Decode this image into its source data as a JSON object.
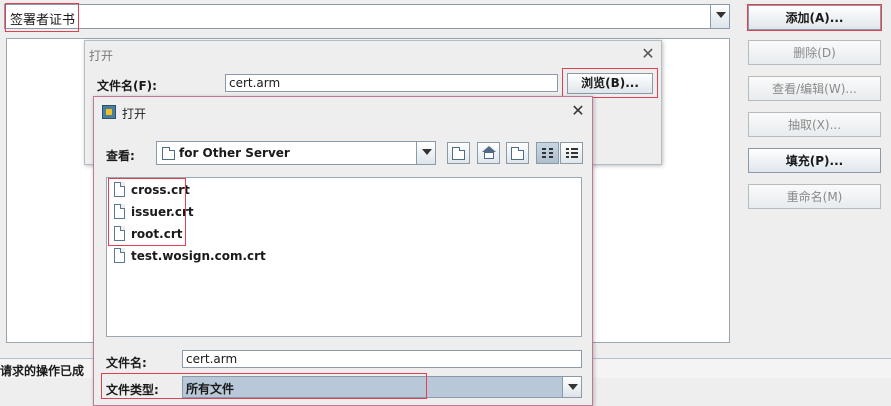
{
  "main": {
    "cert_type_selected": "签署者证书",
    "buttons": {
      "add": "添加(A)...",
      "delete": "删除(D)",
      "view_edit": "查看/编辑(W)...",
      "extract": "抽取(X)...",
      "fill": "填充(P)...",
      "rename": "重命名(M)"
    },
    "status_text": "请求的操作已成"
  },
  "outer_dialog": {
    "title": "打开",
    "filename_label": "文件名(F):",
    "filename_value": "cert.arm",
    "browse_button": "浏览(B)..."
  },
  "file_chooser": {
    "title": "打开",
    "look_in_label": "查看:",
    "look_in_value": "for Other Server",
    "files": [
      "cross.crt",
      "issuer.crt",
      "root.crt",
      "test.wosign.com.crt"
    ],
    "filename_label": "文件名:",
    "filename_value": "cert.arm",
    "filetype_label": "文件类型:",
    "filetype_value": "所有文件"
  },
  "colors": {
    "highlight_box": "#e04050",
    "selection_fill": "#b8c8d8"
  },
  "icons": {
    "close": "close-icon",
    "folder": "folder-icon",
    "file": "file-icon",
    "up_folder": "up-folder-icon",
    "home": "home-icon",
    "new_folder": "new-folder-icon",
    "list_view": "list-view-icon",
    "details_view": "details-view-icon"
  }
}
